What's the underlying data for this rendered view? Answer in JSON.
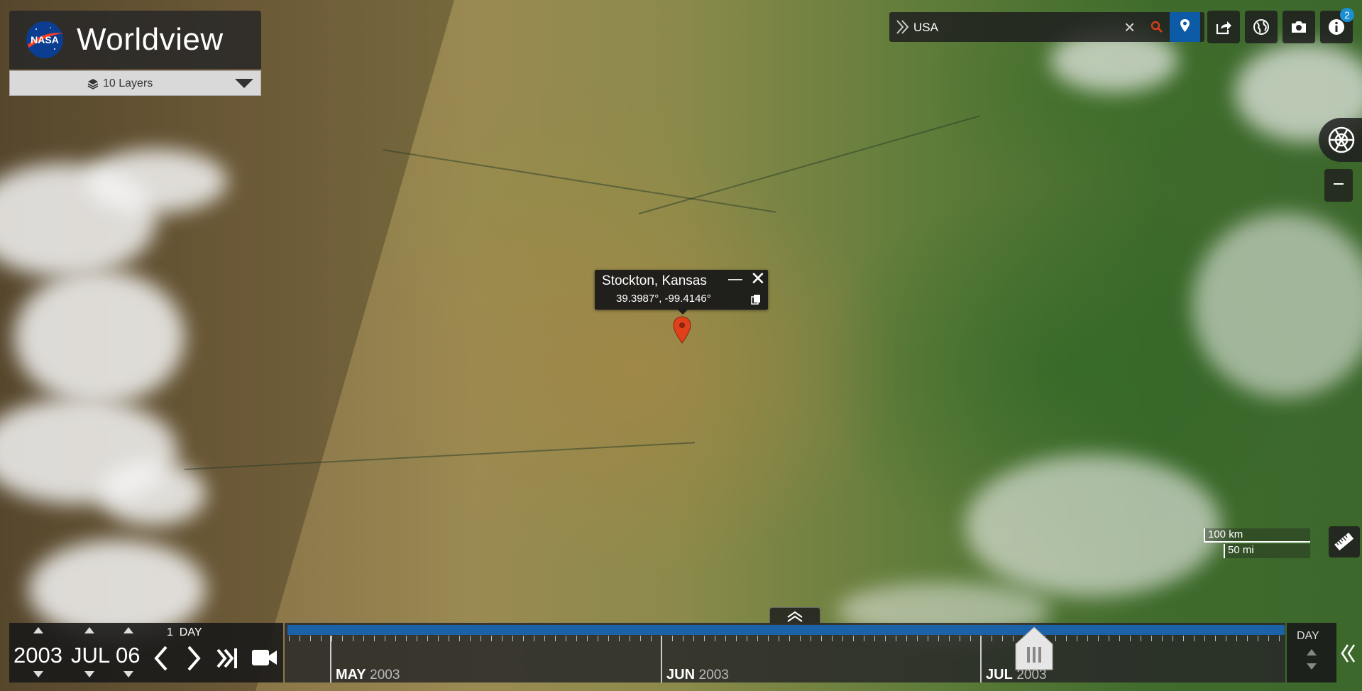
{
  "brand": {
    "agency": "NASA",
    "title": "Worldview"
  },
  "layers": {
    "label": "10 Layers"
  },
  "search": {
    "value": "USA"
  },
  "toolbar": {
    "notification_count": "2"
  },
  "popup": {
    "title": "Stockton, Kansas",
    "coords": "39.3987°, -99.4146°"
  },
  "scale": {
    "km": "100 km",
    "mi": "50 mi"
  },
  "date": {
    "year": "2003",
    "month": "JUL",
    "day": "06",
    "interval_count": "1",
    "interval_unit": "DAY"
  },
  "timeline": {
    "months": [
      {
        "month": "MAY",
        "year": "2003"
      },
      {
        "month": "JUN",
        "year": "2003"
      },
      {
        "month": "JUL",
        "year": "2003"
      }
    ],
    "zoom_level": "DAY"
  },
  "colors": {
    "accent": "#0d5aa7",
    "marker": "#e0401a",
    "timeline_bar": "#1c62a8"
  }
}
